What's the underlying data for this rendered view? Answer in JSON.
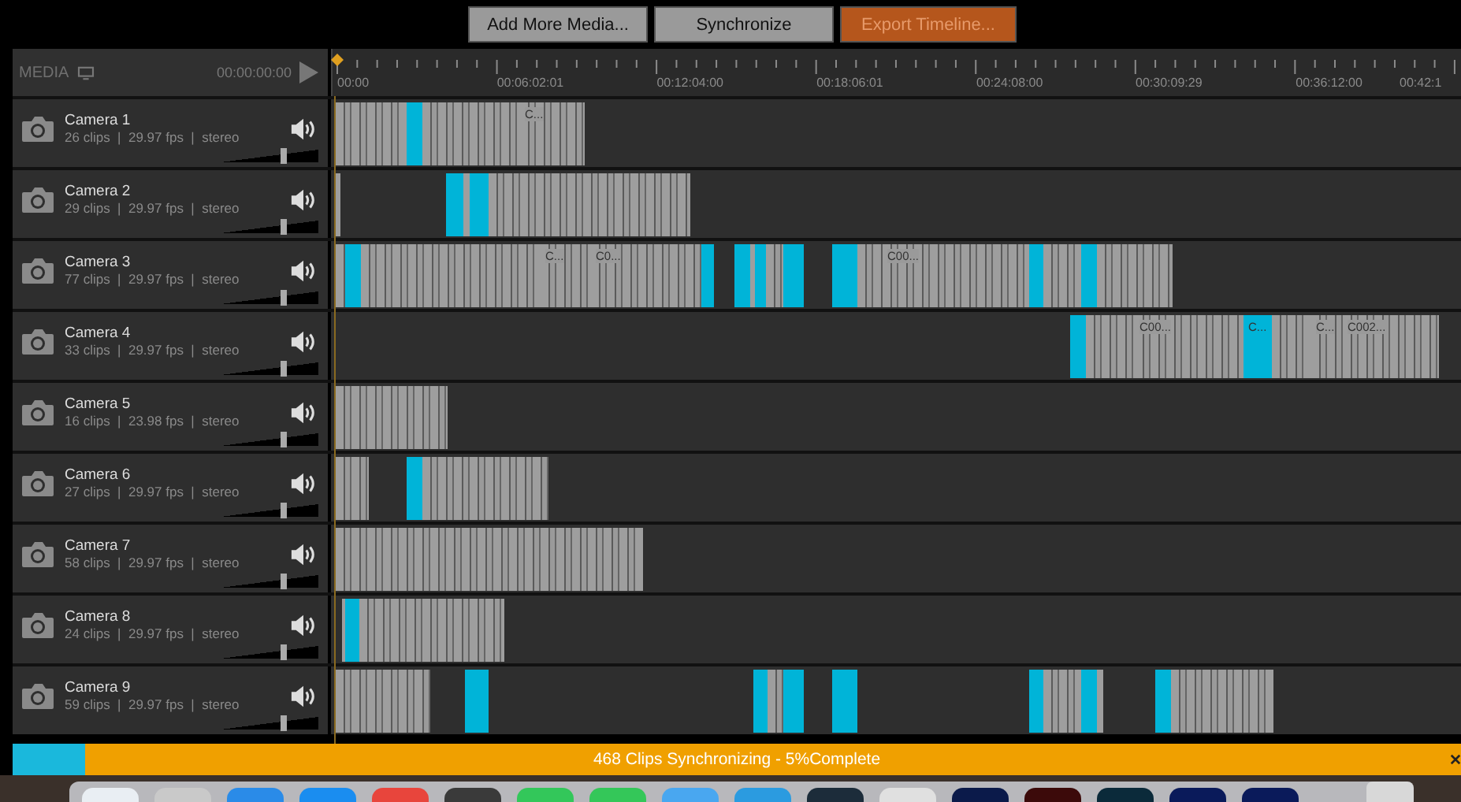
{
  "toolbar": {
    "buttons": [
      {
        "label": "Add More Media...",
        "kind": "normal"
      },
      {
        "label": "Synchronize",
        "kind": "normal"
      },
      {
        "label": "Export Timeline...",
        "kind": "export"
      }
    ]
  },
  "media_header": {
    "label": "MEDIA",
    "timecode": "00:00:00:00"
  },
  "ruler": {
    "labels": [
      "00:00",
      "00:06:02:01",
      "00:12:04:00",
      "00:18:06:01",
      "00:24:08:00",
      "00:30:09:29",
      "00:36:12:00",
      "00:42:1"
    ]
  },
  "tracks": [
    {
      "name": "Camera 1",
      "info": "26 clips  |  29.97 fps  |  stereo",
      "level": 0.65,
      "clip_labels": [
        "C..."
      ]
    },
    {
      "name": "Camera 2",
      "info": "29 clips  |  29.97 fps  |  stereo",
      "level": 0.65
    },
    {
      "name": "Camera 3",
      "info": "77 clips  |  29.97 fps  |  stereo",
      "level": 0.65,
      "clip_labels": [
        "C...",
        "C0...",
        "C00..."
      ]
    },
    {
      "name": "Camera 4",
      "info": "33 clips  |  29.97 fps  |  stereo",
      "level": 0.65,
      "clip_labels": [
        "C00...",
        "C...",
        "C...",
        "C002..."
      ]
    },
    {
      "name": "Camera 5",
      "info": "16 clips  |  23.98 fps  |  stereo",
      "level": 0.65
    },
    {
      "name": "Camera 6",
      "info": "27 clips  |  29.97 fps  |  stereo",
      "level": 0.65
    },
    {
      "name": "Camera 7",
      "info": "58 clips  |  29.97 fps  |  stereo",
      "level": 0.65
    },
    {
      "name": "Camera 8",
      "info": "24 clips  |  29.97 fps  |  stereo",
      "level": 0.65
    },
    {
      "name": "Camera 9",
      "info": "59 clips  |  29.97 fps  |  stereo",
      "level": 0.65
    }
  ],
  "progress": {
    "text": "468 Clips Synchronizing - 5%Complete",
    "level": 0.05
  }
}
